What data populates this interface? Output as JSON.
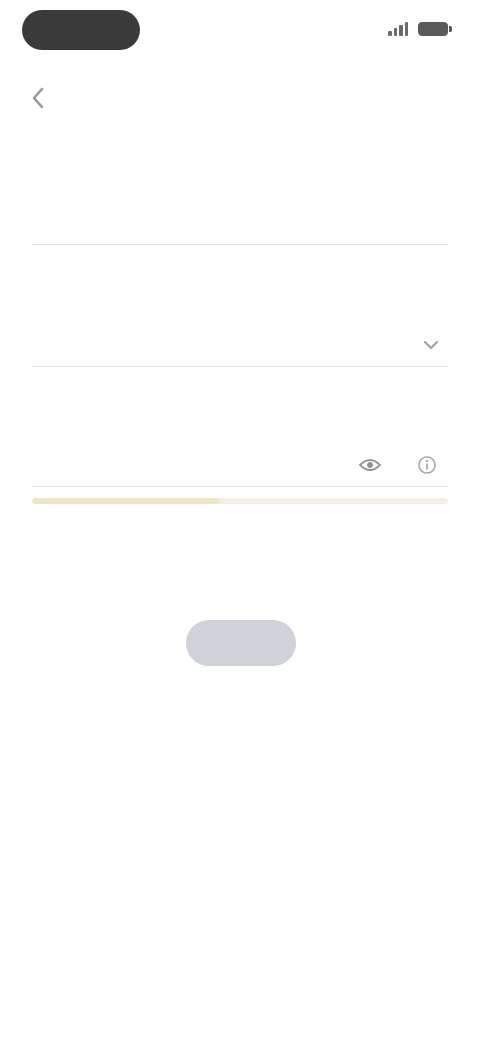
{
  "status_bar": {
    "time": "",
    "icons": [
      "signal-icon",
      "battery-icon"
    ]
  },
  "header": {
    "title": "",
    "back_icon": "chevron-left-icon"
  },
  "form": {
    "fields": [
      {
        "label": "",
        "placeholder": "",
        "value": ""
      },
      {
        "label": "",
        "placeholder": "",
        "value": "",
        "icon": "chevron-down-icon"
      },
      {
        "label": "",
        "placeholder": "",
        "value": "",
        "icons": [
          "eye-icon",
          "info-icon"
        ]
      }
    ],
    "strength": 0.45,
    "note": "",
    "submit_label": ""
  },
  "promo": {
    "line1": "",
    "line2": ""
  },
  "footer": {
    "line1": "",
    "line2": ""
  },
  "colors": {
    "button_disabled": "#cfd2d6",
    "time_pill": "#3a3a3a",
    "strength_track": "#f4efe4",
    "strength_fill": "#efe4c6"
  }
}
